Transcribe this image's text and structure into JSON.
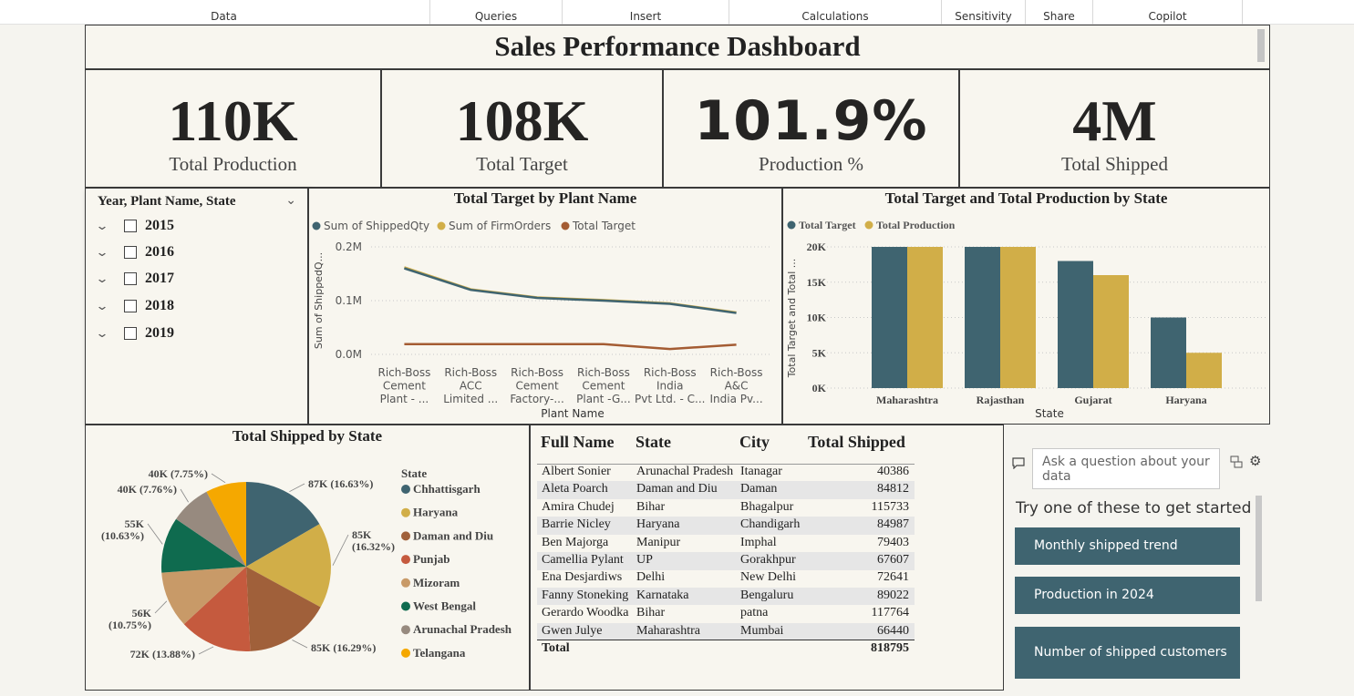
{
  "ribbon": {
    "groups": [
      "Data",
      "Queries",
      "Insert",
      "Calculations",
      "Sensitivity",
      "Share",
      "Copilot"
    ]
  },
  "dashboard": {
    "title": "Sales Performance Dashboard"
  },
  "kpis": [
    {
      "value": "110K",
      "label": "Total Production"
    },
    {
      "value": "108K",
      "label": "Total Target"
    },
    {
      "value": "101.9%",
      "label": "Production %"
    },
    {
      "value": "4M",
      "label": "Total Shipped"
    }
  ],
  "slicer": {
    "header": "Year, Plant Name, State",
    "years": [
      "2015",
      "2016",
      "2017",
      "2018",
      "2019"
    ]
  },
  "chart_data": [
    {
      "type": "line",
      "title": "Total Target by Plant Name",
      "xlabel": "Plant Name",
      "ylabel": "Sum of ShippedQ...",
      "categories": [
        "Rich-Boss Cement Plant - ...",
        "Rich-Boss ACC Limited ...",
        "Rich-Boss Cement Factory-...",
        "Rich-Boss Cement Plant -G...",
        "Rich-Boss India Pvt Ltd. - C...",
        "Rich-Boss A&C India Pv..."
      ],
      "ytick_labels": [
        "0.0M",
        "0.1M",
        "0.2M"
      ],
      "ylim": [
        0,
        0.2
      ],
      "series": [
        {
          "name": "Sum of ShippedQty",
          "color": "#3f6470",
          "values": [
            0.16,
            0.12,
            0.105,
            0.1,
            0.094,
            0.077
          ]
        },
        {
          "name": "Sum of FirmOrders",
          "color": "#d1ae48",
          "values": [
            0.162,
            0.121,
            0.106,
            0.101,
            0.095,
            0.078
          ]
        },
        {
          "name": "Total Target",
          "color": "#a45c33",
          "values": [
            0.019,
            0.019,
            0.019,
            0.019,
            0.01,
            0.018
          ]
        }
      ],
      "legend": "top-left",
      "grid": true
    },
    {
      "type": "bar",
      "title": "Total Target and Total Production by State",
      "xlabel": "State",
      "ylabel": "Total Target and Total ...",
      "categories": [
        "Maharashtra",
        "Rajasthan",
        "Gujarat",
        "Haryana"
      ],
      "ytick_labels": [
        "0K",
        "5K",
        "10K",
        "15K",
        "20K"
      ],
      "ylim": [
        0,
        20000
      ],
      "series": [
        {
          "name": "Total Target",
          "color": "#3f6470",
          "values": [
            20000,
            20000,
            18000,
            10000
          ]
        },
        {
          "name": "Total Production",
          "color": "#d1ae48",
          "values": [
            20000,
            20000,
            16000,
            5000
          ]
        }
      ],
      "legend": "top-left",
      "grid": true
    },
    {
      "type": "pie",
      "title": "Total Shipped by State",
      "legend_title": "State",
      "slices": [
        {
          "name": "Chhattisgarh",
          "value": 87000,
          "pct": 16.63,
          "label": "87K (16.63%)",
          "color": "#3f6470"
        },
        {
          "name": "Haryana",
          "value": 85000,
          "pct": 16.32,
          "label": "85K (16.32%)",
          "color": "#d1ae48"
        },
        {
          "name": "Daman and Diu",
          "value": 85000,
          "pct": 16.29,
          "label": "85K (16.29%)",
          "color": "#a0603a"
        },
        {
          "name": "Punjab",
          "value": 72000,
          "pct": 13.88,
          "label": "72K (13.88%)",
          "color": "#c55a3e"
        },
        {
          "name": "Mizoram",
          "value": 56000,
          "pct": 10.75,
          "label": "56K (10.75%)",
          "color": "#c89a68"
        },
        {
          "name": "West Bengal",
          "value": 55000,
          "pct": 10.63,
          "label": "55K (10.63%)",
          "color": "#0f6b4f"
        },
        {
          "name": "Arunachal Pradesh",
          "value": 40000,
          "pct": 7.76,
          "label": "40K (7.76%)",
          "color": "#978a7f"
        },
        {
          "name": "Telangana",
          "value": 40000,
          "pct": 7.75,
          "label": "40K (7.75%)",
          "color": "#f5a800"
        }
      ],
      "legend": "right"
    }
  ],
  "table": {
    "columns": [
      "Full Name",
      "State",
      "City",
      "Total Shipped"
    ],
    "rows": [
      [
        "Albert Sonier",
        "Arunachal Pradesh",
        "Itanagar",
        "40386"
      ],
      [
        "Aleta Poarch",
        "Daman and Diu",
        "Daman",
        "84812"
      ],
      [
        "Amira Chudej",
        "Bihar",
        "Bhagalpur",
        "115733"
      ],
      [
        "Barrie Nicley",
        "Haryana",
        "Chandigarh",
        "84987"
      ],
      [
        "Ben Majorga",
        "Manipur",
        "Imphal",
        "79403"
      ],
      [
        "Camellia Pylant",
        "UP",
        "Gorakhpur",
        "67607"
      ],
      [
        "Ena Desjardiws",
        "Delhi",
        "New Delhi",
        "72641"
      ],
      [
        "Fanny Stoneking",
        "Karnataka",
        "Bengaluru",
        "89022"
      ],
      [
        "Gerardo Woodka",
        "Bihar",
        "patna",
        "117764"
      ],
      [
        "Gwen Julye",
        "Maharashtra",
        "Mumbai",
        "66440"
      ]
    ],
    "total_label": "Total",
    "total_value": "818795"
  },
  "qa": {
    "placeholder": "Ask a question about your data",
    "prompt": "Try one of these to get started",
    "suggestions": [
      "Monthly shipped trend",
      "Production in 2024",
      "Number of shipped customers"
    ]
  },
  "colors": {
    "teal": "#3f6470",
    "gold": "#d1ae48",
    "rust": "#a45c33",
    "panel_bg": "#f8f6ef"
  }
}
